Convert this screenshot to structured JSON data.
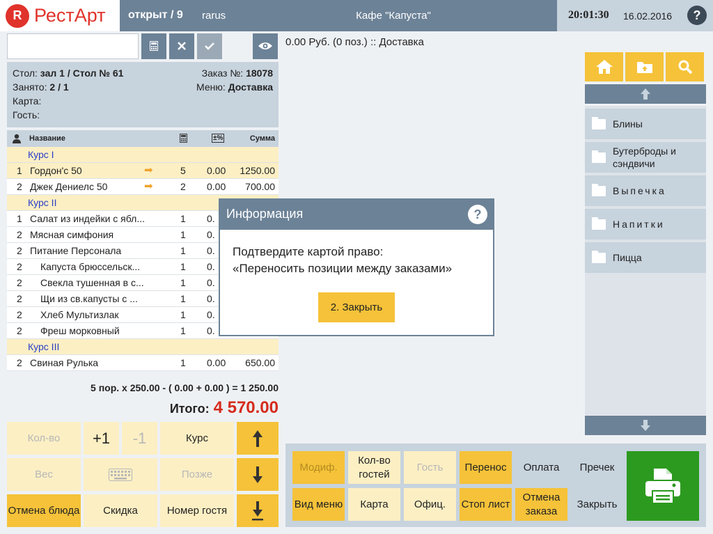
{
  "header": {
    "logo_mark": "R",
    "logo_text": "РестАрт",
    "status": "открыт / 9",
    "user": "rarus",
    "cafe": "Кафе \"Капуста\"",
    "time": "20:01:30",
    "date": "16.02.2016",
    "help": "?"
  },
  "order": {
    "table_label": "Стол:",
    "table_value": "зал 1 / Стол № 61",
    "order_label": "Заказ №:",
    "order_value": "18078",
    "occupied_label": "Занято:",
    "occupied_value": "2 / 1",
    "menu_label": "Меню:",
    "menu_value": "Доставка",
    "card_label": "Карта:",
    "guest_label": "Гость:"
  },
  "table": {
    "col_name": "Название",
    "col_disc": "±%",
    "col_sum": "Сумма",
    "course1": "Курс I",
    "course2": "Курс II",
    "course3": "Курс III",
    "rows": [
      {
        "num": "1",
        "name": "Гордон'с 50",
        "qty": "5",
        "disc": "0.00",
        "sum": "1250.00"
      },
      {
        "num": "2",
        "name": "Джек Дениелс 50",
        "qty": "2",
        "disc": "0.00",
        "sum": "700.00"
      },
      {
        "num": "1",
        "name": "Салат из индейки с ябл...",
        "qty": "1",
        "disc": "0."
      },
      {
        "num": "2",
        "name": "Мясная симфония",
        "qty": "1",
        "disc": "0."
      },
      {
        "num": "2",
        "name": "Питание Персонала",
        "qty": "1",
        "disc": "0."
      },
      {
        "num": "2",
        "name": "Капуста брюссельск...",
        "qty": "1",
        "disc": "0."
      },
      {
        "num": "2",
        "name": "Свекла тушенная в с...",
        "qty": "1",
        "disc": "0."
      },
      {
        "num": "2",
        "name": "Щи из св.капусты с ...",
        "qty": "1",
        "disc": "0."
      },
      {
        "num": "2",
        "name": "Хлеб Мультизлак",
        "qty": "1",
        "disc": "0."
      },
      {
        "num": "2",
        "name": "Фреш морковный",
        "qty": "1",
        "disc": "0."
      },
      {
        "num": "2",
        "name": "Свиная Рулька",
        "qty": "1",
        "disc": "0.00",
        "sum": "650.00"
      }
    ]
  },
  "calc_line": "5 пор. x 250.00 - ( 0.00 + 0.00 ) = 1 250.00",
  "total": {
    "label": "Итого:",
    "value": "4 570.00"
  },
  "left_buttons": {
    "qty": "Кол-во",
    "plus": "+1",
    "minus": "-1",
    "course": "Курс",
    "weight": "Вес",
    "later": "Позже",
    "cancel_dish": "Отмена блюда",
    "discount": "Скидка",
    "guest_number": "Номер гостя"
  },
  "summary": "0.00 Руб. (0 поз.)  ::  Доставка",
  "categories": [
    "Блины",
    "Бутерброды и сэндвичи",
    "Выпечка",
    "Напитки",
    "Пицца"
  ],
  "right_buttons": {
    "modif": "Модиф.",
    "guests_count": "Кол-во гостей",
    "guest": "Гость",
    "transfer": "Перенос",
    "payment": "Оплата",
    "precheck": "Пречек",
    "menu_view": "Вид меню",
    "card": "Карта",
    "waiter": "Офиц.",
    "stop_list": "Стоп лист",
    "cancel_order": "Отмена заказа",
    "close": "Закрыть"
  },
  "modal": {
    "title": "Информация",
    "line1": "Подтвердите картой право:",
    "line2": "«Переносить позиции между заказами»",
    "button": "2. Закрыть"
  },
  "colors": {
    "accent": "#f5c239",
    "header": "#6c8297",
    "total": "#d52b1e",
    "print": "#2c9a1f"
  }
}
